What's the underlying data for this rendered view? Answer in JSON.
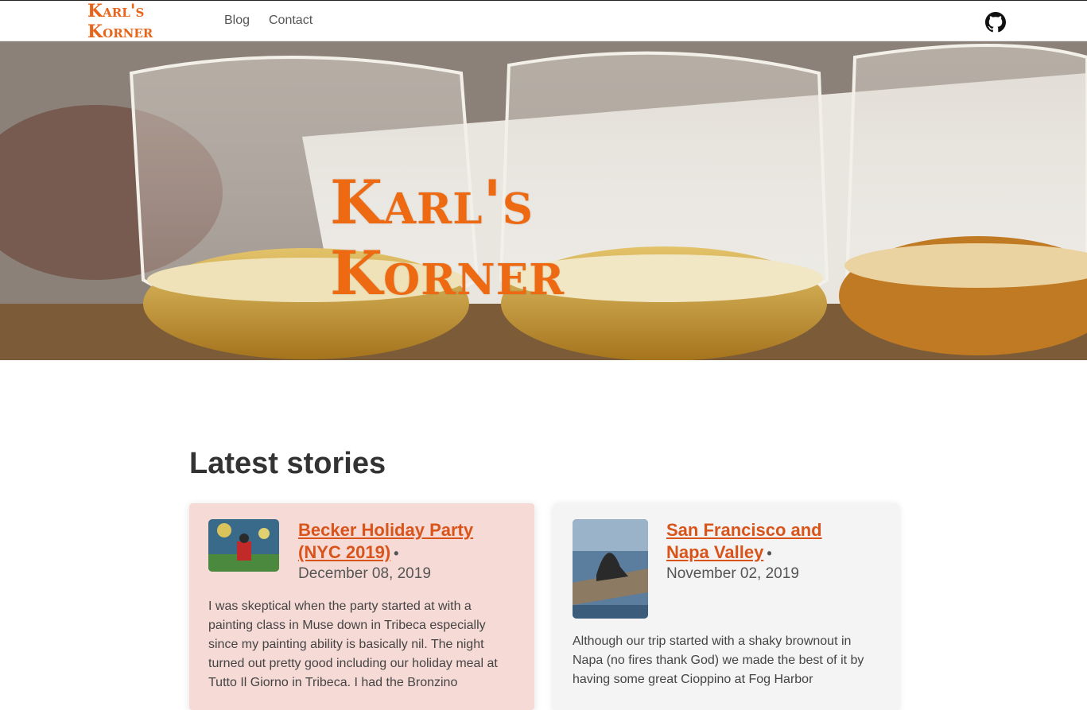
{
  "nav": {
    "brand": "Karl's Korner",
    "links": [
      "Blog",
      "Contact"
    ]
  },
  "icons": {
    "github": "github-icon"
  },
  "colors": {
    "brand_orange": "#ee6a12",
    "link_orange": "#d9541a",
    "card_highlight": "#f6dad6",
    "card_default": "#f4f4f4"
  },
  "hero": {
    "logo_text": "Karl's Korner"
  },
  "main": {
    "section_title": "Latest stories",
    "stories": [
      {
        "title": "Becker Holiday Party (NYC 2019)",
        "separator": "•",
        "date": "December 08, 2019",
        "excerpt": "I was skeptical when the party started at with a painting class in Muse down in Tribeca especially since my painting ability is basically nil. The night turned out pretty good including our holiday meal at Tutto Il Giorno in Tribeca. I had the Bronzino"
      },
      {
        "title": "San Francisco and Napa Valley",
        "separator": "•",
        "date": "November 02, 2019",
        "excerpt": "Although our trip started with a shaky brownout in Napa (no fires thank God) we made the best of it by having some great Cioppino at Fog Harbor"
      }
    ]
  }
}
